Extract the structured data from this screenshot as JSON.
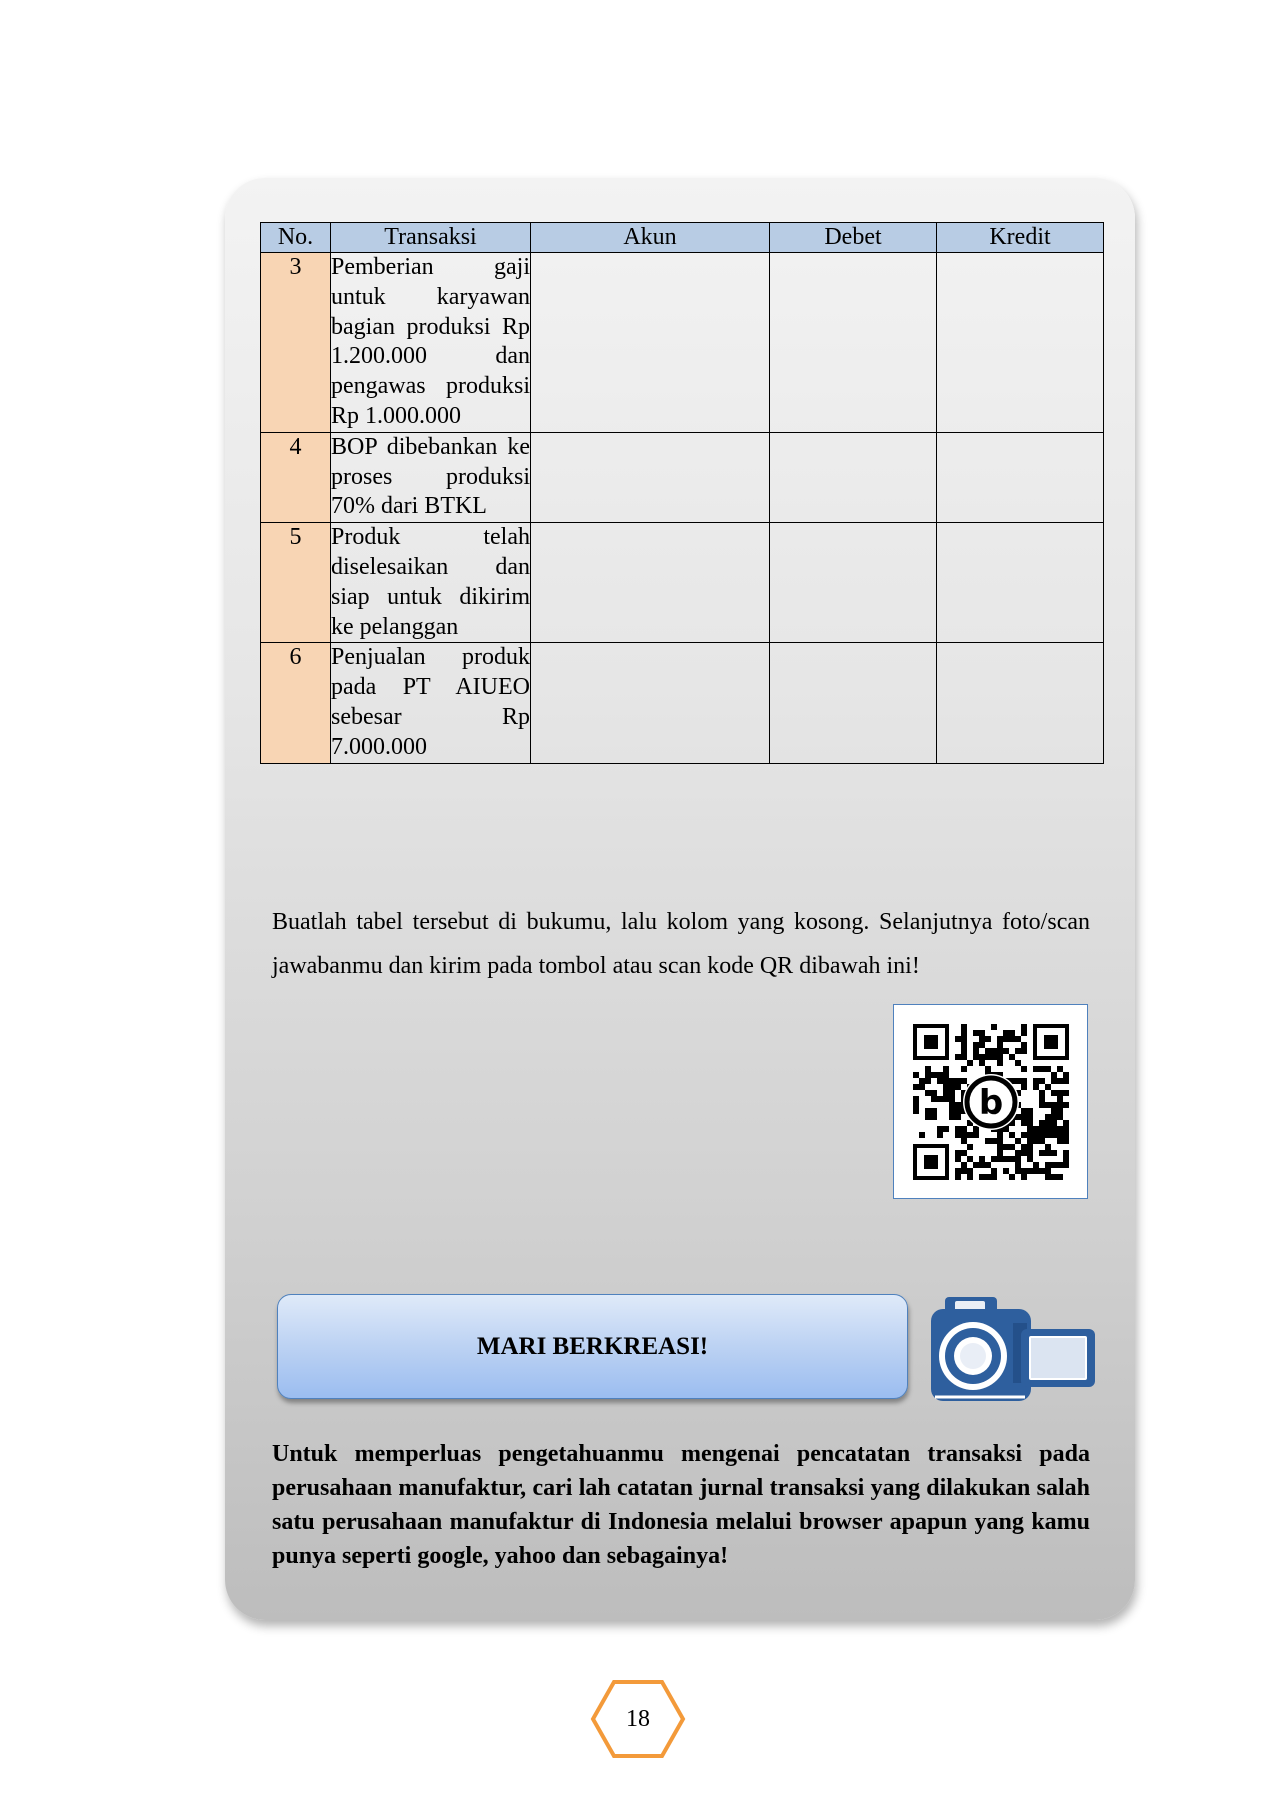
{
  "table": {
    "headers": [
      "No.",
      "Transaksi",
      "Akun",
      "Debet",
      "Kredit"
    ],
    "rows": [
      {
        "no": "3",
        "transaksi": "Pemberian gaji untuk karyawan bagian produksi Rp 1.200.000 dan pengawas produksi Rp 1.000.000",
        "akun": "",
        "debet": "",
        "kredit": ""
      },
      {
        "no": "4",
        "transaksi": "BOP dibebankan ke proses produksi 70% dari BTKL",
        "akun": "",
        "debet": "",
        "kredit": ""
      },
      {
        "no": "5",
        "transaksi": "Produk telah diselesaikan dan siap untuk dikirim ke pelanggan",
        "akun": "",
        "debet": "",
        "kredit": ""
      },
      {
        "no": "6",
        "transaksi": "Penjualan produk pada PT AIUEO sebesar Rp 7.000.000",
        "akun": "",
        "debet": "",
        "kredit": ""
      }
    ]
  },
  "instruction": "Buatlah tabel tersebut di bukumu, lalu kolom yang kosong. Selanjutnya foto/scan jawabanmu dan kirim pada tombol atau scan kode QR dibawah ini!",
  "qr_code": {
    "icon": "qr-code-icon",
    "center_logo": "b"
  },
  "create_button": {
    "label": "MARI BERKREASI!"
  },
  "camera": {
    "icon": "video-camera-icon"
  },
  "enrichment": "Untuk memperluas pengetahuanmu mengenai pencatatan transaksi pada perusahaan manufaktur, cari lah catatan jurnal transaksi yang dilakukan salah satu perusahaan manufaktur di Indonesia melalui browser apapun yang kamu punya seperti google, yahoo dan sebagainya!",
  "page_number": "18",
  "colors": {
    "header_fill": "#b8cce4",
    "number_column_fill": "#f8d5b4",
    "accent_blue": "#4f81bd",
    "camera_blue": "#2e5f9e",
    "page_hexagon": "#f39a3a"
  }
}
